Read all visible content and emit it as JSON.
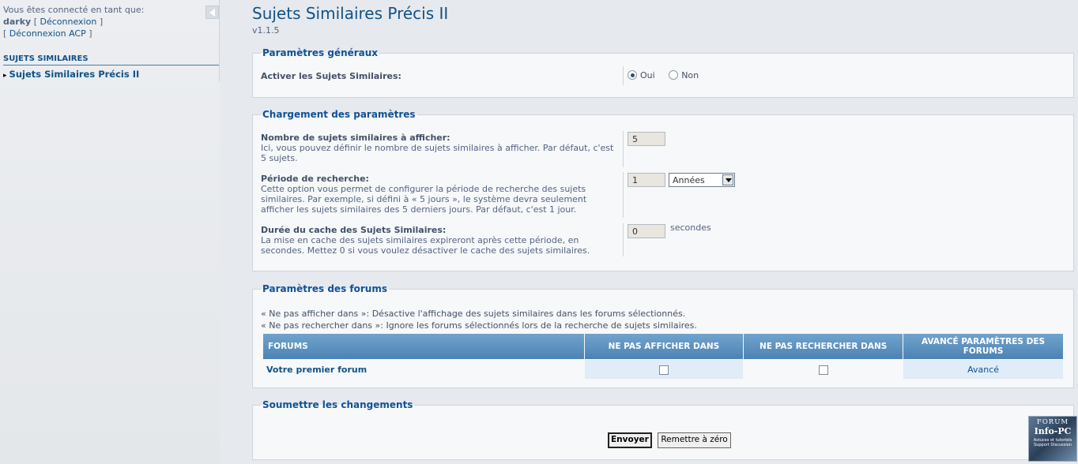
{
  "sidebar": {
    "logged_in_text": "Vous êtes connecté en tant que:",
    "username": "darky",
    "logout_label": "Déconnexion",
    "acp_logout_label": "Déconnexion ACP",
    "bracket_open": "[",
    "bracket_close": "]",
    "menu_header": "SUJETS SIMILAIRES",
    "menu_item": "Sujets Similaires Précis II"
  },
  "page": {
    "title": "Sujets Similaires Précis II",
    "version": "v1.1.5"
  },
  "general": {
    "legend": "Paramètres généraux",
    "enable_label": "Activer les Sujets Similaires:",
    "yes_label": "Oui",
    "no_label": "Non",
    "selected": "Oui"
  },
  "loading": {
    "legend": "Chargement des paramètres",
    "count_title": "Nombre de sujets similaires à afficher:",
    "count_desc": "Ici, vous pouvez définir le nombre de sujets similaires à afficher. Par défaut, c'est 5 sujets.",
    "count_value": "5",
    "period_title": "Période de recherche:",
    "period_desc": "Cette option vous permet de configurer la période de recherche des sujets similaires. Par exemple, si défini à « 5 jours », le système devra seulement afficher les sujets similaires des 5 derniers jours. Par défaut, c'est 1 jour.",
    "period_value": "1",
    "period_unit": "Années",
    "cache_title": "Durée du cache des Sujets Similaires:",
    "cache_desc": "La mise en cache des sujets similaires expireront après cette période, en secondes. Mettez 0 si vous voulez désactiver le cache des sujets similaires.",
    "cache_value": "0",
    "cache_unit": "secondes"
  },
  "forums": {
    "legend": "Paramètres des forums",
    "note1": "« Ne pas afficher dans »: Désactive l'affichage des sujets similaires dans les forums sélectionnés.",
    "note2": "« Ne pas rechercher dans »: Ignore les forums sélectionnés lors de la recherche de sujets similaires.",
    "columns": [
      "FORUMS",
      "NE PAS AFFICHER DANS",
      "NE PAS RECHERCHER DANS",
      "AVANCÉ PARAMÈTRES DES FORUMS"
    ],
    "rows": [
      {
        "name": "Votre premier forum",
        "hide": false,
        "exclude": false,
        "advanced": "Avancé"
      }
    ]
  },
  "submit": {
    "legend": "Soumettre les changements",
    "submit_label": "Envoyer",
    "reset_label": "Remettre à zéro"
  },
  "watermark": {
    "line1": "FORUM",
    "line2": "Info-PC",
    "line3": "Astuces et tutoriels Support Discussion"
  }
}
